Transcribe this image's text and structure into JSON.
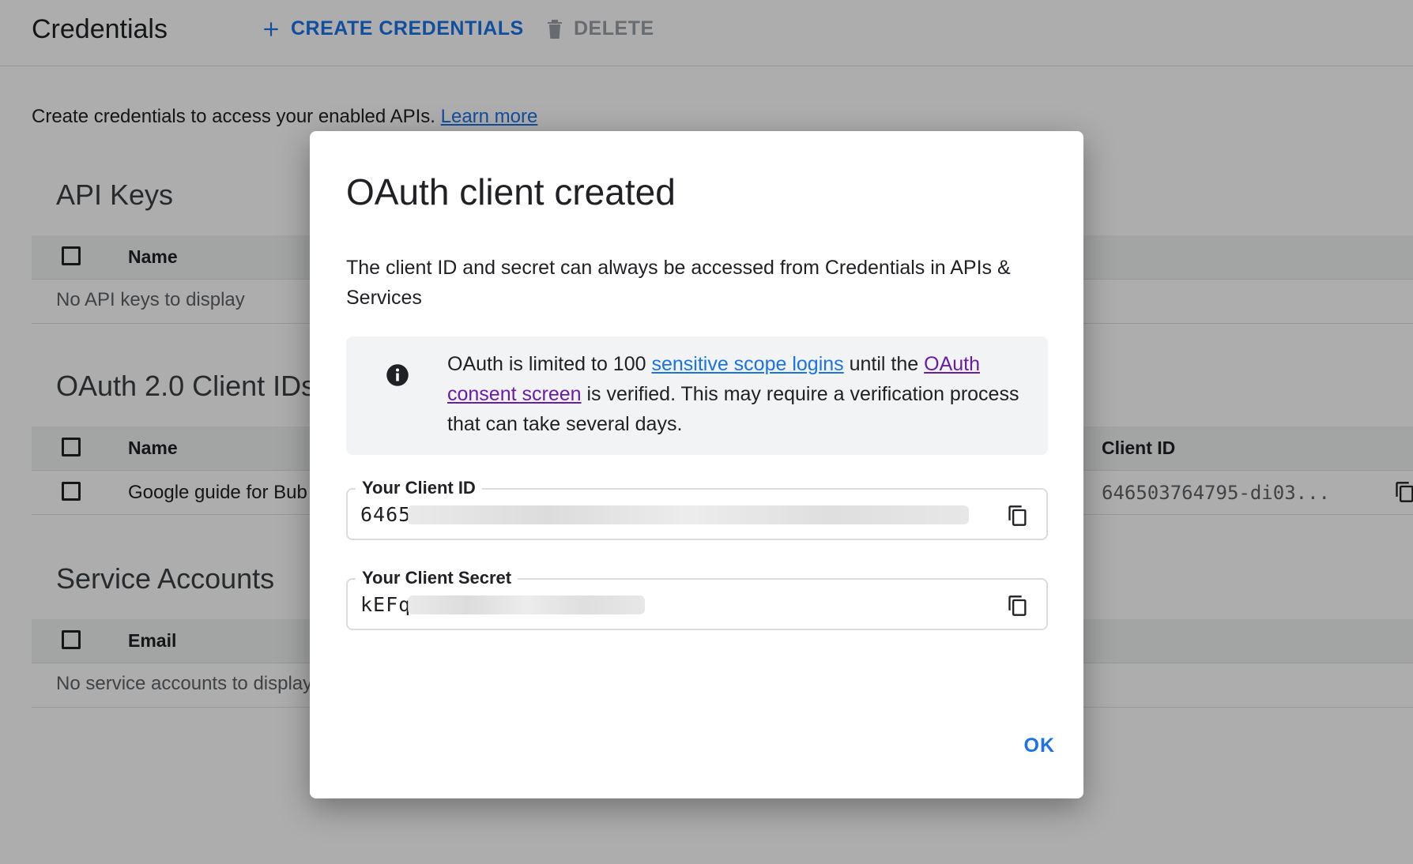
{
  "toolbar": {
    "title": "Credentials",
    "create_label": "CREATE CREDENTIALS",
    "delete_label": "DELETE"
  },
  "intro": {
    "text": "Create credentials to access your enabled APIs.",
    "link": "Learn more"
  },
  "api_keys": {
    "title": "API Keys",
    "columns": [
      "Name"
    ],
    "empty": "No API keys to display"
  },
  "oauth": {
    "title": "OAuth 2.0 Client IDs",
    "columns": [
      "Name",
      "Client ID"
    ],
    "rows": [
      {
        "name": "Google guide for Bub",
        "client_id": "646503764795-di03..."
      }
    ]
  },
  "service_accounts": {
    "title": "Service Accounts",
    "columns": [
      "Email"
    ],
    "empty": "No service accounts to display"
  },
  "dialog": {
    "title": "OAuth client created",
    "description": "The client ID and secret can always be accessed from Credentials in APIs & Services",
    "notice": {
      "icon": "info-icon",
      "part1": "OAuth is limited to 100 ",
      "link1": "sensitive scope logins",
      "part2": " until the ",
      "link2": "OAuth consent screen",
      "part3": " is verified. This may require a verification process that can take several days."
    },
    "client_id": {
      "label": "Your Client ID",
      "value_visible": "6465"
    },
    "client_secret": {
      "label": "Your Client Secret",
      "value_visible": "kEFq"
    },
    "ok_label": "OK"
  },
  "colors": {
    "accent": "#1a73e8",
    "visited_link": "#681da8",
    "notice_bg": "#f1f3f4"
  }
}
